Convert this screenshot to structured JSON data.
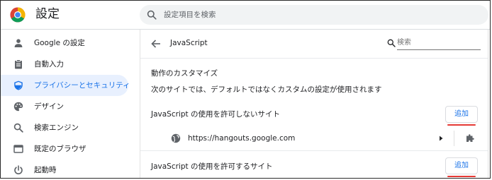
{
  "header": {
    "title": "設定",
    "search_placeholder": "設定項目を検索"
  },
  "sidebar": {
    "items": [
      {
        "label": "Google の設定",
        "icon": "person-icon",
        "active": false
      },
      {
        "label": "自動入力",
        "icon": "clipboard-icon",
        "active": false
      },
      {
        "label": "プライバシーとセキュリティ",
        "icon": "shield-icon",
        "active": true
      },
      {
        "label": "デザイン",
        "icon": "palette-icon",
        "active": false
      },
      {
        "label": "検索エンジン",
        "icon": "search-icon",
        "active": false
      },
      {
        "label": "既定のブラウザ",
        "icon": "browser-icon",
        "active": false
      },
      {
        "label": "起動時",
        "icon": "power-icon",
        "active": false
      }
    ]
  },
  "main": {
    "title": "JavaScript",
    "search_placeholder": "検索",
    "section_heading": "動作のカスタマイズ",
    "section_description": "次のサイトでは、デフォルトではなくカスタムの設定が使用されます",
    "blocked": {
      "label": "JavaScript の使用を許可しないサイト",
      "add_label": "追加",
      "sites": [
        "https://hangouts.google.com"
      ]
    },
    "allowed": {
      "label": "JavaScript の使用を許可するサイト",
      "add_label": "追加"
    }
  },
  "colors": {
    "accent": "#1a73e8",
    "active_bg": "#e8f0fe",
    "highlight_underline": "#e53935",
    "search_bg": "#f1f3f4"
  }
}
